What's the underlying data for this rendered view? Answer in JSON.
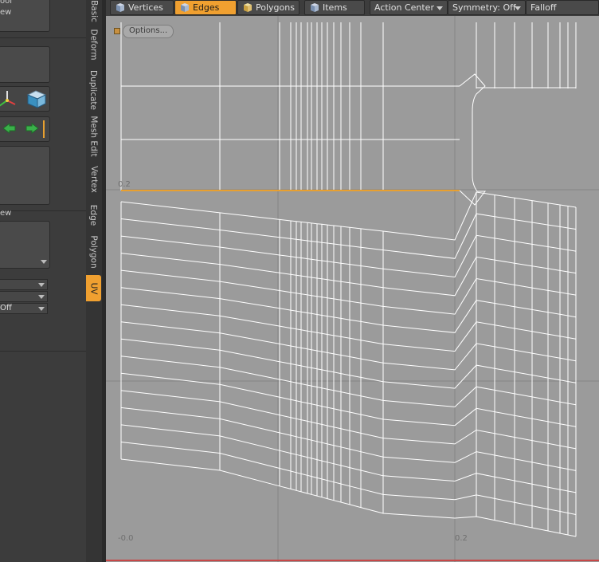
{
  "left_panel": {
    "labels": [
      "ool",
      "ew",
      "ew"
    ],
    "dropdowns": [
      "",
      "",
      "Off"
    ]
  },
  "vertical_tabs": [
    "Basic",
    "Deform",
    "Duplicate",
    "Mesh Edit",
    "Vertex",
    "Edge",
    "Polygon",
    "UV"
  ],
  "active_tab": "UV",
  "toolbar": {
    "modes": [
      "Vertices",
      "Edges",
      "Polygons",
      "Items"
    ],
    "selected_mode": "Edges",
    "action_center": "Action Center",
    "symmetry": "Symmetry: Off",
    "falloff": "Falloff"
  },
  "viewport": {
    "options_label": "Options...",
    "axis_labels": {
      "y_top": "0.2",
      "x_left": "-0.0",
      "x_right": "0.2"
    }
  },
  "colors": {
    "accent": "#f0a030",
    "viewport_bg": "#9b9b9b",
    "wire": "#ffffff",
    "grid": "#848484",
    "selected_edge": "#e8a030"
  }
}
